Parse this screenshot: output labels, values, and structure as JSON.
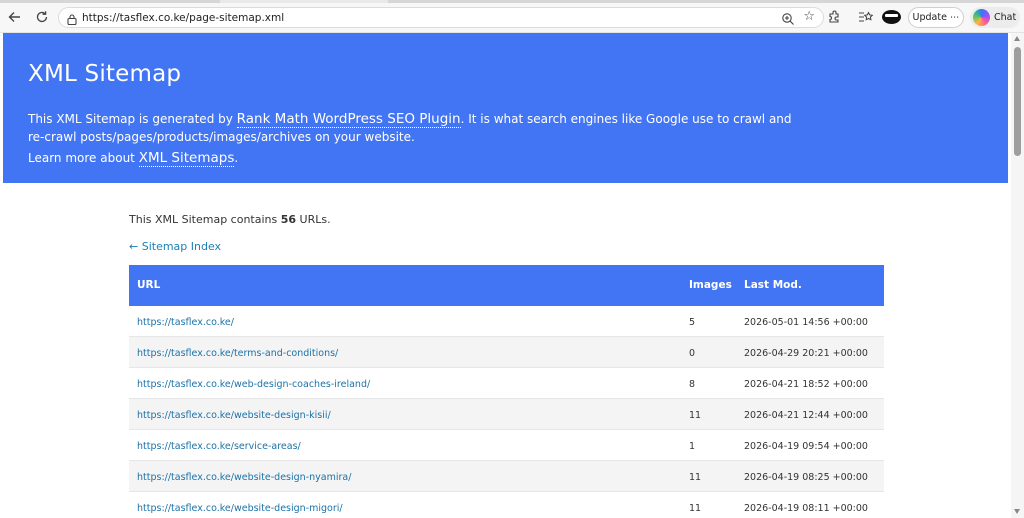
{
  "browser": {
    "url": "https://tasflex.co.ke/page-sitemap.xml",
    "update_label": "Update ⋯",
    "chat_label": "Chat",
    "icons": [
      "back-icon",
      "reload-icon",
      "lock-icon",
      "zoom-icon",
      "favorite-star-icon",
      "extensions-icon",
      "favorites-icon",
      "profile-avatar-icon",
      "copilot-icon"
    ]
  },
  "header": {
    "title": "XML Sitemap",
    "desc_pre": "This XML Sitemap is generated by ",
    "desc_link": "Rank Math WordPress SEO Plugin",
    "desc_post": ". It is what search engines like Google use to crawl and re-crawl posts/pages/products/images/archives on your website.",
    "more_pre": "Learn more about ",
    "more_link": "XML Sitemaps",
    "more_post": "."
  },
  "summary": {
    "pre": "This XML Sitemap contains ",
    "count": "56",
    "post": " URLs.",
    "back_link": "← Sitemap Index"
  },
  "table": {
    "headers": {
      "url": "URL",
      "images": "Images",
      "lastmod": "Last Mod."
    },
    "rows": [
      {
        "url": "https://tasflex.co.ke/",
        "images": "5",
        "lastmod": "2026-05-01 14:56 +00:00"
      },
      {
        "url": "https://tasflex.co.ke/terms-and-conditions/",
        "images": "0",
        "lastmod": "2026-04-29 20:21 +00:00"
      },
      {
        "url": "https://tasflex.co.ke/web-design-coaches-ireland/",
        "images": "8",
        "lastmod": "2026-04-21 18:52 +00:00"
      },
      {
        "url": "https://tasflex.co.ke/website-design-kisii/",
        "images": "11",
        "lastmod": "2026-04-21 12:44 +00:00"
      },
      {
        "url": "https://tasflex.co.ke/service-areas/",
        "images": "1",
        "lastmod": "2026-04-19 09:54 +00:00"
      },
      {
        "url": "https://tasflex.co.ke/website-design-nyamira/",
        "images": "11",
        "lastmod": "2026-04-19 08:25 +00:00"
      },
      {
        "url": "https://tasflex.co.ke/website-design-migori/",
        "images": "11",
        "lastmod": "2026-04-19 08:11 +00:00"
      }
    ]
  },
  "colors": {
    "accent": "#4275f4",
    "link": "#1b72a8",
    "row_alt": "#f4f4f4"
  }
}
